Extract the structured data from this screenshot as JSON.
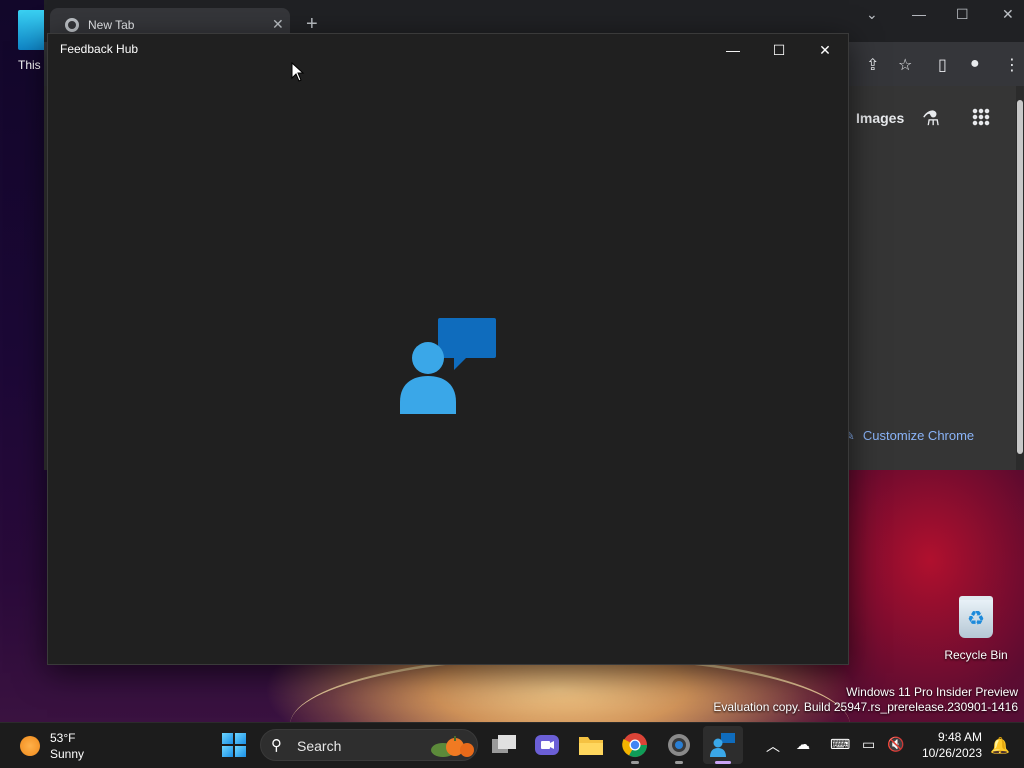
{
  "desktop": {
    "icon_this_pc_label": "This",
    "recycle_bin_label": "Recycle Bin",
    "watermark_line1": "Windows 11 Pro Insider Preview",
    "watermark_line2": "Evaluation copy. Build 25947.rs_prerelease.230901-1416"
  },
  "chrome": {
    "tab_title": "New Tab",
    "tab_close": "✕",
    "new_tab": "+",
    "images_link": "Images",
    "customize_label": "Customize Chrome"
  },
  "feedback_hub": {
    "title": "Feedback Hub",
    "minimize": "—",
    "maximize": "☐",
    "close": "✕"
  },
  "taskbar": {
    "weather_temp": "53°F",
    "weather_cond": "Sunny",
    "search_label": "Search",
    "clock_time": "9:48 AM",
    "clock_date": "10/26/2023"
  },
  "colors": {
    "feedback_bg": "#202020",
    "accent_blue": "#1a8fe6",
    "chrome_link": "#8ab4f8"
  }
}
